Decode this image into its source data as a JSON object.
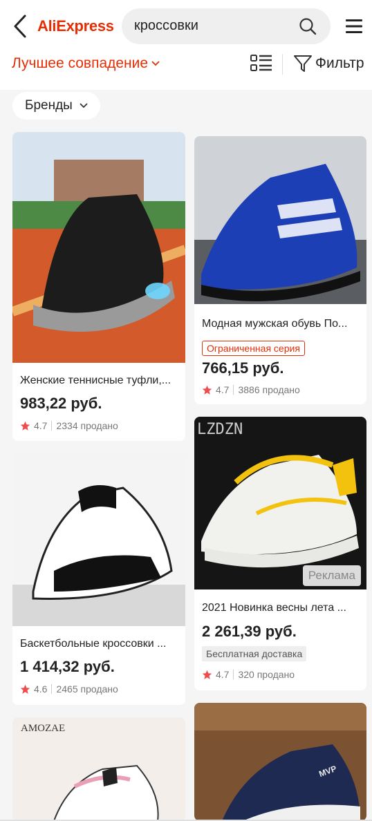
{
  "header": {
    "logo": "AliExpress",
    "search_value": "кроссовки",
    "brand_color": "#e62e04"
  },
  "sortbar": {
    "sort_label": "Лучшее совпадение",
    "filter_label": "Фильтр"
  },
  "chips": {
    "brands_label": "Бренды"
  },
  "products": [
    {
      "title": "Женские теннисные туфли,...",
      "price": "983,22 руб.",
      "rating": "4.7",
      "sold": "2334 продано"
    },
    {
      "title": "Модная мужская обувь По...",
      "badge": "Ограниченная серия",
      "price": "766,15 руб.",
      "rating": "4.7",
      "sold": "3886 продано"
    },
    {
      "title": "Баскетбольные кроссовки ...",
      "price": "1 414,32 руб.",
      "rating": "4.6",
      "sold": "2465 продано"
    },
    {
      "title": "2021 Новинка весны лета ...",
      "badge": "Бесплатная доставка",
      "price": "2 261,39 руб.",
      "rating": "4.7",
      "sold": "320 продано",
      "ad_label": "Реклама",
      "image_caption": "LZDZN"
    },
    {
      "image_caption": "AMOZAE"
    },
    {
      "image_caption": "MVP"
    }
  ]
}
